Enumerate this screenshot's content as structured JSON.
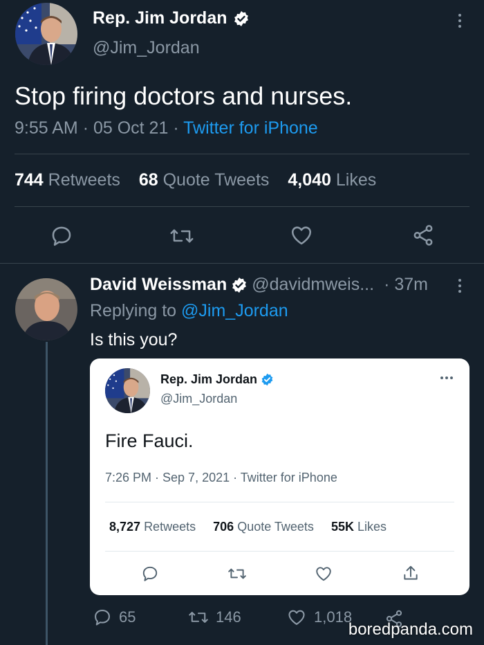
{
  "main_tweet": {
    "author_name": "Rep. Jim Jordan",
    "handle": "@Jim_Jordan",
    "text": "Stop firing doctors and nurses.",
    "time": "9:55 AM",
    "date": "05 Oct 21",
    "source": "Twitter for iPhone",
    "separator": "·",
    "stats": {
      "retweets_count": "744",
      "retweets_label": "Retweets",
      "quotes_count": "68",
      "quotes_label": "Quote Tweets",
      "likes_count": "4,040",
      "likes_label": "Likes"
    },
    "actions": [
      "reply-icon",
      "retweet-icon",
      "like-icon",
      "share-icon"
    ]
  },
  "reply": {
    "author_name": "David Weissman",
    "handle": "@davidmweis...",
    "time_ago": "· 37m",
    "replying_prefix": "Replying to",
    "replying_to": "@Jim_Jordan",
    "text": "Is this you?",
    "counts": {
      "replies": "65",
      "retweets": "146",
      "likes": "1,018"
    }
  },
  "embedded_tweet": {
    "author_name": "Rep. Jim Jordan",
    "handle": "@Jim_Jordan",
    "text": "Fire Fauci.",
    "meta": "7:26 PM · Sep 7, 2021 · Twitter for iPhone",
    "stats": {
      "retweets_count": "8,727",
      "retweets_label": "Retweets",
      "quotes_count": "706",
      "quotes_label": "Quote Tweets",
      "likes_count": "55K",
      "likes_label": "Likes"
    }
  },
  "watermark": "boredpanda.com",
  "colors": {
    "background": "#15202b",
    "accent": "#1d9bf0",
    "muted": "#8b98a5",
    "divider": "#38444d"
  }
}
